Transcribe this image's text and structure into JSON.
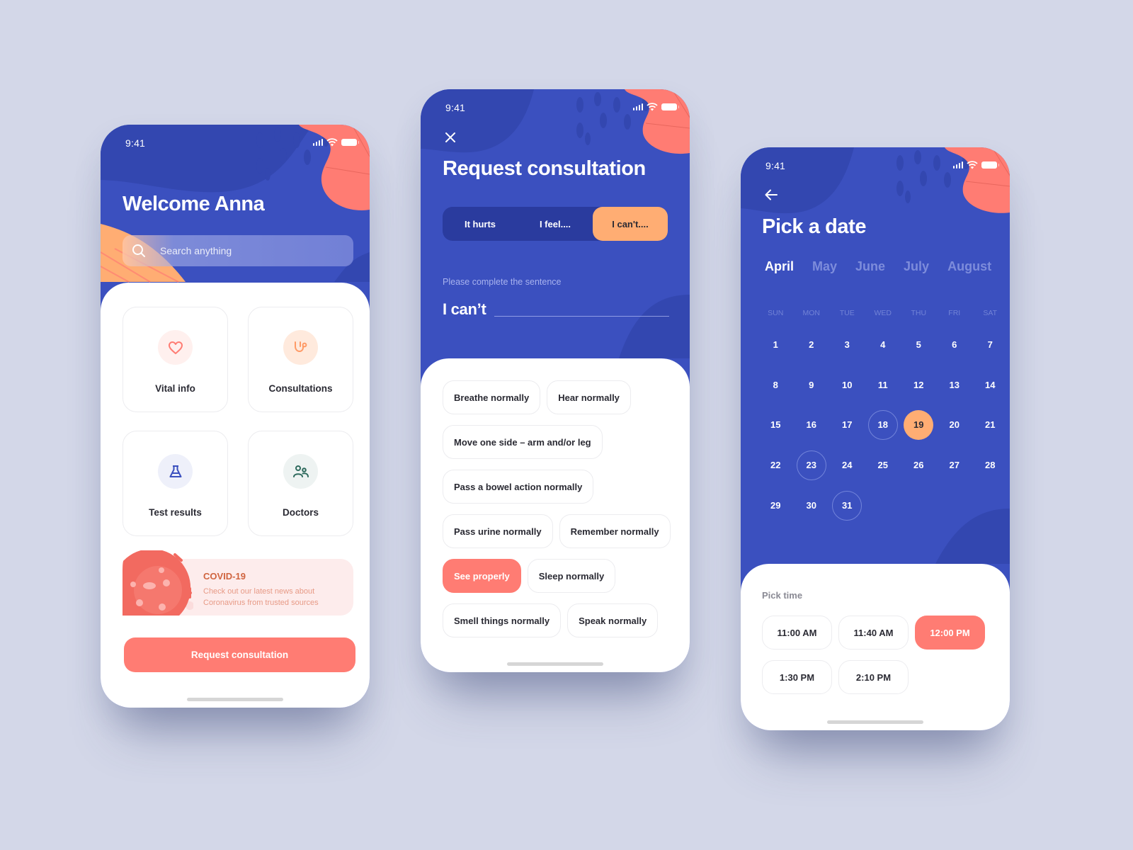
{
  "status_bar": {
    "time": "9:41"
  },
  "home": {
    "greeting": "Welcome Anna",
    "search_placeholder": "Search anything",
    "tiles": [
      {
        "label": "Vital info",
        "icon": "heart-icon",
        "color": "#ff7c73",
        "bg": "#fff0ee"
      },
      {
        "label": "Consultations",
        "icon": "stethoscope-icon",
        "color": "#ff9a66",
        "bg": "#ffeadd"
      },
      {
        "label": "Test results",
        "icon": "flask-icon",
        "color": "#3b50bf",
        "bg": "#eef0fa"
      },
      {
        "label": "Doctors",
        "icon": "users-icon",
        "color": "#2f6b5e",
        "bg": "#eef3f2"
      }
    ],
    "covid": {
      "title": "COVID-19",
      "text": "Check out our latest news about Coronavirus from trusted sources"
    },
    "cta": "Request consultation"
  },
  "consultation": {
    "title": "Request consultation",
    "tabs": [
      {
        "label": "It hurts",
        "active": false
      },
      {
        "label": "I feel....",
        "active": false
      },
      {
        "label": "I can't....",
        "active": true
      }
    ],
    "prompt": "Please complete the sentence",
    "sentence_lead": "I can’t",
    "sentence_value": "",
    "options": [
      [
        {
          "label": "Breathe normally",
          "selected": false
        },
        {
          "label": "Hear normally",
          "selected": false
        }
      ],
      [
        {
          "label": "Move one side – arm and/or leg",
          "selected": false
        }
      ],
      [
        {
          "label": "Pass a bowel action normally",
          "selected": false
        }
      ],
      [
        {
          "label": "Pass urine normally",
          "selected": false
        },
        {
          "label": "Remember normally",
          "selected": false
        }
      ],
      [
        {
          "label": "See properly",
          "selected": true
        },
        {
          "label": "Sleep normally",
          "selected": false
        }
      ],
      [
        {
          "label": "Smell things normally",
          "selected": false
        },
        {
          "label": "Speak normally",
          "selected": false
        }
      ]
    ]
  },
  "date_picker": {
    "title": "Pick a date",
    "months": [
      {
        "label": "April",
        "active": true
      },
      {
        "label": "May",
        "active": false
      },
      {
        "label": "June",
        "active": false
      },
      {
        "label": "July",
        "active": false
      },
      {
        "label": "August",
        "active": false
      }
    ],
    "weekdays": [
      "SUN",
      "MON",
      "TUE",
      "WED",
      "THU",
      "FRI",
      "SAT"
    ],
    "days_in_month": 31,
    "first_weekday_index": 0,
    "available_days": [
      18,
      23,
      31
    ],
    "selected_day": 19,
    "pick_time_label": "Pick time",
    "times": [
      {
        "label": "11:00 AM",
        "selected": false
      },
      {
        "label": "11:40 AM",
        "selected": false
      },
      {
        "label": "12:00 PM",
        "selected": true
      },
      {
        "label": "1:30 PM",
        "selected": false
      },
      {
        "label": "2:10 PM",
        "selected": false
      }
    ]
  },
  "colors": {
    "primary_blue": "#3b50bf",
    "dark_blue": "#2a3b9e",
    "coral": "#ff7c73",
    "orange": "#ffad73",
    "background": "#d3d7e8"
  }
}
